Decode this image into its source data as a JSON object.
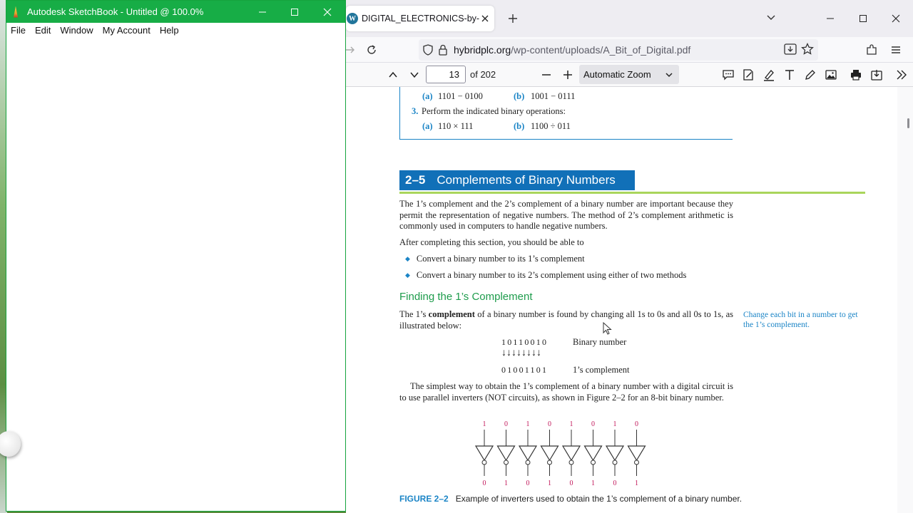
{
  "sketchbook": {
    "title": "Autodesk SketchBook - Untitled @ 100.0%",
    "menu": [
      "File",
      "Edit",
      "Window",
      "My Account",
      "Help"
    ]
  },
  "browser": {
    "tab_title": "DIGITAL_ELECTRONICS-by-Flyo",
    "tab_favicon": "W",
    "url_domain": "hybridplc.org",
    "url_path": "/wp-content/uploads/A_Bit_of_Digital.pdf"
  },
  "pdf_toolbar": {
    "page_number": "13",
    "page_count": "of 202",
    "zoom": "Automatic Zoom"
  },
  "pdf": {
    "review_item_a1_label": "(a)",
    "review_item_a1": "1101 − 0100",
    "review_item_b1_label": "(b)",
    "review_item_b1": "1001 − 0111",
    "review_q3_num": "3.",
    "review_q3": "Perform the indicated binary operations:",
    "review_item_a2_label": "(a)",
    "review_item_a2": "110 × 111",
    "review_item_b2_label": "(b)",
    "review_item_b2": "1100 ÷ 011",
    "section_number": "2–5",
    "section_title": "Complements of Binary Numbers",
    "intro_paragraph": "The 1’s complement and the 2’s complement of a binary number are important because they permit the representation of negative numbers. The method of 2’s complement arithmetic is commonly used in computers to handle negative numbers.",
    "objectives_lead": "After completing this section, you should be able to",
    "objectives": [
      "Convert a binary number to its 1’s complement",
      "Convert a binary number to its 2’s complement using either of two methods"
    ],
    "subheading": "Finding the 1’s Complement",
    "para2_before": "The 1’s ",
    "para2_bold": "complement",
    "para2_after": " of a binary number is found by changing all 1s to 0s and all 0s to 1s, as illustrated below:",
    "margin_note": "Change each bit in a number to get the 1’s complement.",
    "binary_number": "10110010",
    "binary_number_label": "Binary number",
    "arrows": "↓↓↓↓↓↓↓↓",
    "complement_number": "01001101",
    "complement_label": "1’s complement",
    "para3": "The simplest way to obtain the 1’s complement of a binary number with a digital circuit is to use parallel inverters (NOT circuits), as shown in Figure 2–2 for an 8-bit binary number.",
    "figure_inputs": [
      "1",
      "0",
      "1",
      "0",
      "1",
      "0",
      "1",
      "0"
    ],
    "figure_outputs": [
      "0",
      "1",
      "0",
      "1",
      "0",
      "1",
      "0",
      "1"
    ],
    "figure_label": "FIGURE 2–2",
    "figure_caption": "Example of inverters used to obtain the 1’s complement of a binary number."
  },
  "colors": {
    "sketchbook_green": "#17ad46",
    "section_blue": "#1170b8",
    "accent_blue": "#1a84c6",
    "subheading_green": "#1e9c4c",
    "rule_green": "#a9d55b",
    "figure_pink": "#c2185b"
  }
}
